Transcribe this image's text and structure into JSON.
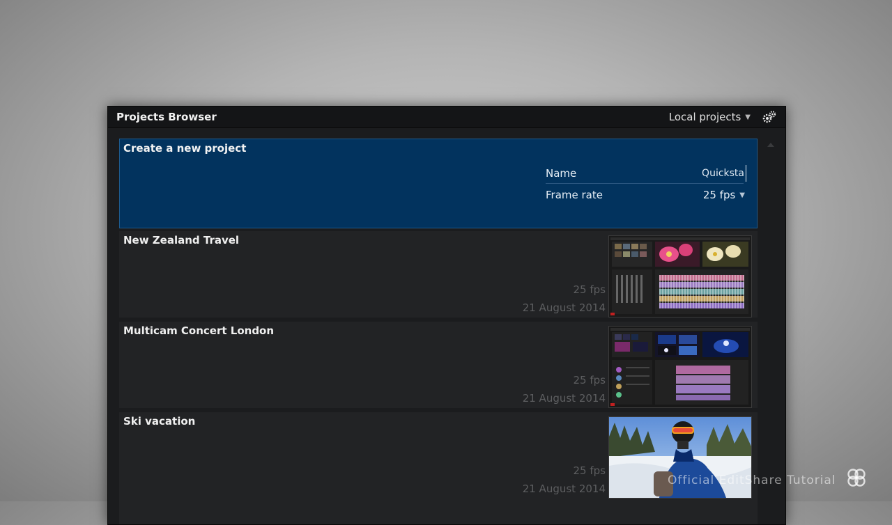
{
  "window": {
    "title": "Projects Browser",
    "source_dropdown": "Local projects",
    "settings_icon": "gear-icon"
  },
  "new_project": {
    "heading": "Create a new project",
    "name_label": "Name",
    "name_value": "Quicksta",
    "framerate_label": "Frame rate",
    "framerate_value": "25 fps"
  },
  "projects": [
    {
      "name": "New Zealand Travel",
      "fps": "25 fps",
      "date": "21 August 2014"
    },
    {
      "name": "Multicam Concert London",
      "fps": "25 fps",
      "date": "21 August 2014"
    },
    {
      "name": "Ski vacation",
      "fps": "25 fps",
      "date": "21 August 2014"
    }
  ],
  "watermark": "Official EditShare Tutorial",
  "colors": {
    "accent": "#02335e",
    "panel": "#222325",
    "background": "#1b1c1e"
  }
}
